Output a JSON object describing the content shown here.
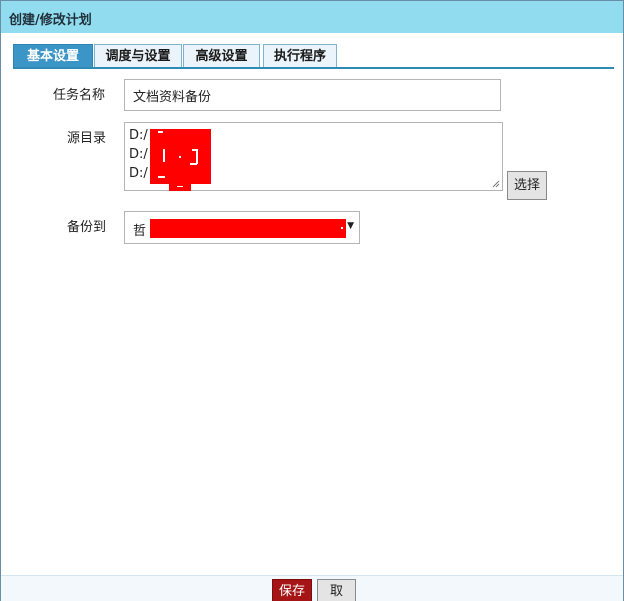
{
  "window": {
    "title": "创建/修改计划"
  },
  "tabs": [
    {
      "label": "基本设置",
      "active": true
    },
    {
      "label": "调度与设置",
      "active": false
    },
    {
      "label": "高级设置",
      "active": false
    },
    {
      "label": "执行程序",
      "active": false
    }
  ],
  "form": {
    "task_name_label": "任务名称",
    "task_name_value": "文档资料备份",
    "source_dir_label": "源目录",
    "source_dir_lines": [
      "D:/",
      "D:/",
      "D:/"
    ],
    "choose_button": "选择",
    "backup_to_label": "备份到",
    "backup_to_value": "哲"
  },
  "footer": {
    "save_label": "保存",
    "cancel_label": "取消"
  },
  "colors": {
    "titlebar_bg": "#92dcf0",
    "tab_active_bg": "#3b95c6",
    "save_bg": "#a51515",
    "redaction": "#ff0000"
  }
}
